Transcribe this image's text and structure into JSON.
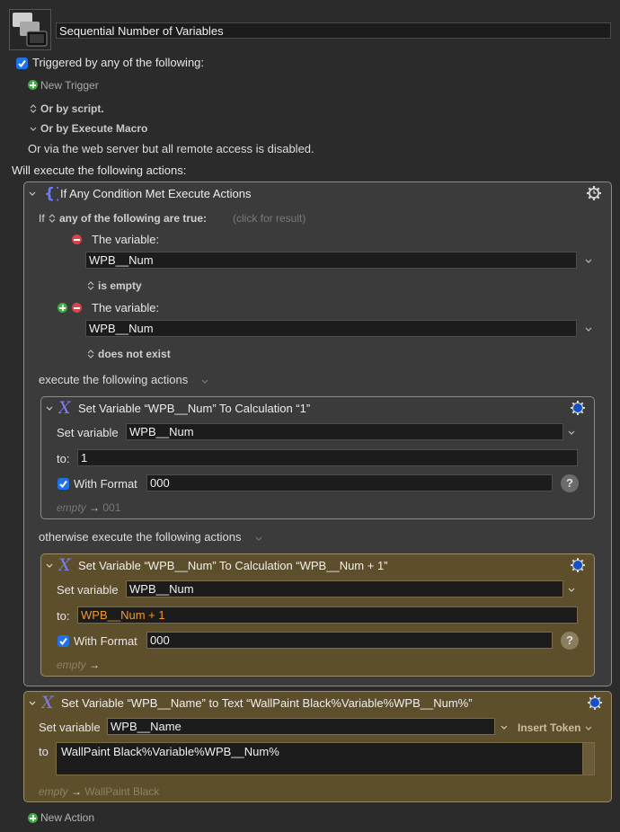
{
  "macro": {
    "name": "Sequential Number of Variables",
    "icon": "stacked-windows-icon"
  },
  "triggers": {
    "enabled": true,
    "label": "Triggered by any of the following:",
    "new_trigger": "New Trigger",
    "or_by_script": "Or by script.",
    "or_by_execute_macro": "Or by Execute Macro",
    "web_server_note": "Or via the web server but all remote access is disabled."
  },
  "will_execute": "Will execute the following actions:",
  "if_action": {
    "title": "If Any Condition Met Execute Actions",
    "icon": "curly-braces-icon",
    "if_label": "If",
    "condition_mode": "any of the following are true:",
    "click_for_result": "(click for result)",
    "conditions": [
      {
        "label": "The variable:",
        "variable": "WPB__Num",
        "test": "is empty"
      },
      {
        "label": "The variable:",
        "variable": "WPB__Num",
        "test": "does not exist"
      }
    ],
    "execute_label": "execute the following actions",
    "otherwise_label": "otherwise execute the following actions",
    "then_action": {
      "title": "Set Variable “WPB__Num” To Calculation “1”",
      "set_variable_label": "Set variable",
      "variable": "WPB__Num",
      "to_label": "to:",
      "to_value": "1",
      "with_format_checked": true,
      "with_format_label": "With Format",
      "format_value": "000",
      "preview_empty": "empty",
      "preview_arrow": "→",
      "preview_result": "001",
      "help": "?"
    },
    "else_action": {
      "title": "Set Variable “WPB__Num” To Calculation “WPB__Num + 1”",
      "set_variable_label": "Set variable",
      "variable": "WPB__Num",
      "to_label": "to:",
      "to_value": "WPB__Num + 1",
      "with_format_checked": true,
      "with_format_label": "With Format",
      "format_value": "000",
      "preview_empty": "empty",
      "preview_arrow": "→",
      "preview_result": "",
      "help": "?"
    }
  },
  "text_action": {
    "title": "Set Variable “WPB__Name” to Text “WallPaint Black%Variable%WPB__Num%”",
    "set_variable_label": "Set variable",
    "variable": "WPB__Name",
    "insert_token": "Insert Token",
    "to_label": "to",
    "text_value": "WallPaint Black%Variable%WPB__Num%",
    "preview_empty": "empty",
    "preview_arrow": "→",
    "preview_result": "WallPaint Black"
  },
  "new_action": "New Action",
  "colors": {
    "background": "#2b2b2b",
    "panel": "#3b3b3b",
    "selected_action": "#5e4f2c",
    "checkbox": "#1f72e8",
    "add_green": "#3fae3f",
    "remove_red": "#d9434a",
    "calc_orange": "#f39a2b",
    "gear_active": "#1451c4",
    "token_icon": "#7b7cf0"
  }
}
